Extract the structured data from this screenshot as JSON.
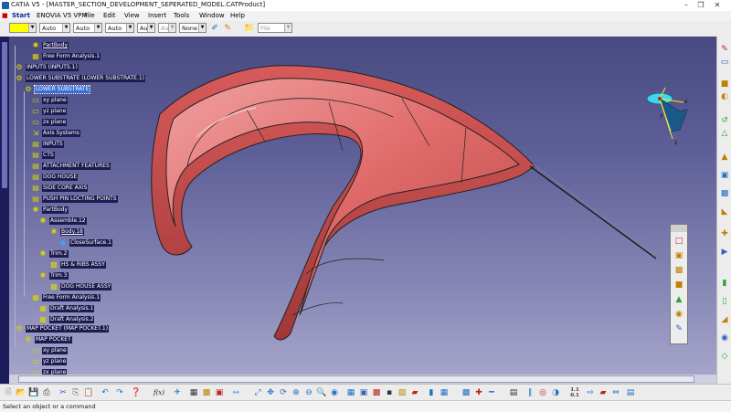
{
  "titlebar": {
    "title": "CATIA V5 - [MASTER_SECTION_DEVELOPMENT_SEPERATED_MODEL.CATProduct]",
    "minimize": "–",
    "restore": "❒",
    "close": "✕"
  },
  "menu": {
    "start": "Start",
    "items": [
      "ENOVIA V5 VPM",
      "File",
      "Edit",
      "View",
      "Insert",
      "Tools",
      "Window",
      "Help"
    ]
  },
  "properties": {
    "color_swatch": "#ffff00",
    "combos": [
      "Auto",
      "Auto",
      "Auto",
      "Aut",
      "Aut",
      "None"
    ],
    "file_placeholder": "File"
  },
  "tree": {
    "nodes": [
      {
        "label": "PartBody",
        "icon": "part-body-icon"
      },
      {
        "label": "Free Form Analysis.1",
        "icon": "analysis-icon"
      },
      {
        "label": "INPUTS (INPUTS.1)",
        "icon": "product-icon"
      },
      {
        "label": "LOWER SUBSTRATE (LOWER SUBSTRATE.1)",
        "icon": "product-icon"
      },
      {
        "label": "LOWER SUBSTRATE",
        "icon": "part-icon"
      },
      {
        "label": "xy plane",
        "icon": "plane-icon"
      },
      {
        "label": "yz plane",
        "icon": "plane-icon"
      },
      {
        "label": "zx plane",
        "icon": "plane-icon"
      },
      {
        "label": "Axis Systems",
        "icon": "axis-icon"
      },
      {
        "label": "INPUTS",
        "icon": "geoset-icon"
      },
      {
        "label": "CTS",
        "icon": "geoset-icon"
      },
      {
        "label": "ATTACHMENT FEATURES",
        "icon": "geoset-icon"
      },
      {
        "label": "DOG HOUSE",
        "icon": "geoset-icon"
      },
      {
        "label": "SIDE CORE AXIS",
        "icon": "geoset-icon"
      },
      {
        "label": "PUSH PIN LOCTING POINTS",
        "icon": "geoset-icon"
      },
      {
        "label": "PartBody",
        "icon": "part-body-icon"
      },
      {
        "label": "Assemble.12",
        "icon": "assemble-icon"
      },
      {
        "label": "Body.18",
        "icon": "body-icon"
      },
      {
        "label": "CloseSurface.1",
        "icon": "close-surface-icon"
      },
      {
        "label": "Trim.2",
        "icon": "trim-icon"
      },
      {
        "label": "HS & RIBS ASSY",
        "icon": "body-icon"
      },
      {
        "label": "Trim.3",
        "icon": "trim-icon"
      },
      {
        "label": "DOG HOUSE ASSY",
        "icon": "body-icon"
      },
      {
        "label": "Free Form Analysis.1",
        "icon": "analysis-icon"
      },
      {
        "label": "Draft Analysis.1",
        "icon": "analysis-icon"
      },
      {
        "label": "Draft Analysis.2",
        "icon": "analysis-icon"
      },
      {
        "label": "MAP POCKET (MAP POCKET.1)",
        "icon": "product-icon"
      },
      {
        "label": "MAP POCKET",
        "icon": "part-icon"
      },
      {
        "label": "xy plane",
        "icon": "plane-icon"
      },
      {
        "label": "yz plane",
        "icon": "plane-icon"
      },
      {
        "label": "zx plane",
        "icon": "plane-icon"
      }
    ]
  },
  "compass": {
    "x": "x",
    "y": "y",
    "z": "z"
  },
  "viewport": {
    "part_color": "#e06a6a",
    "edge_color": "#222222"
  },
  "statusbar": {
    "message": "Select an object or a command"
  },
  "bottom_text": {
    "fog": "f(x)",
    "scale": "1.1",
    "scale2": "0.1"
  }
}
